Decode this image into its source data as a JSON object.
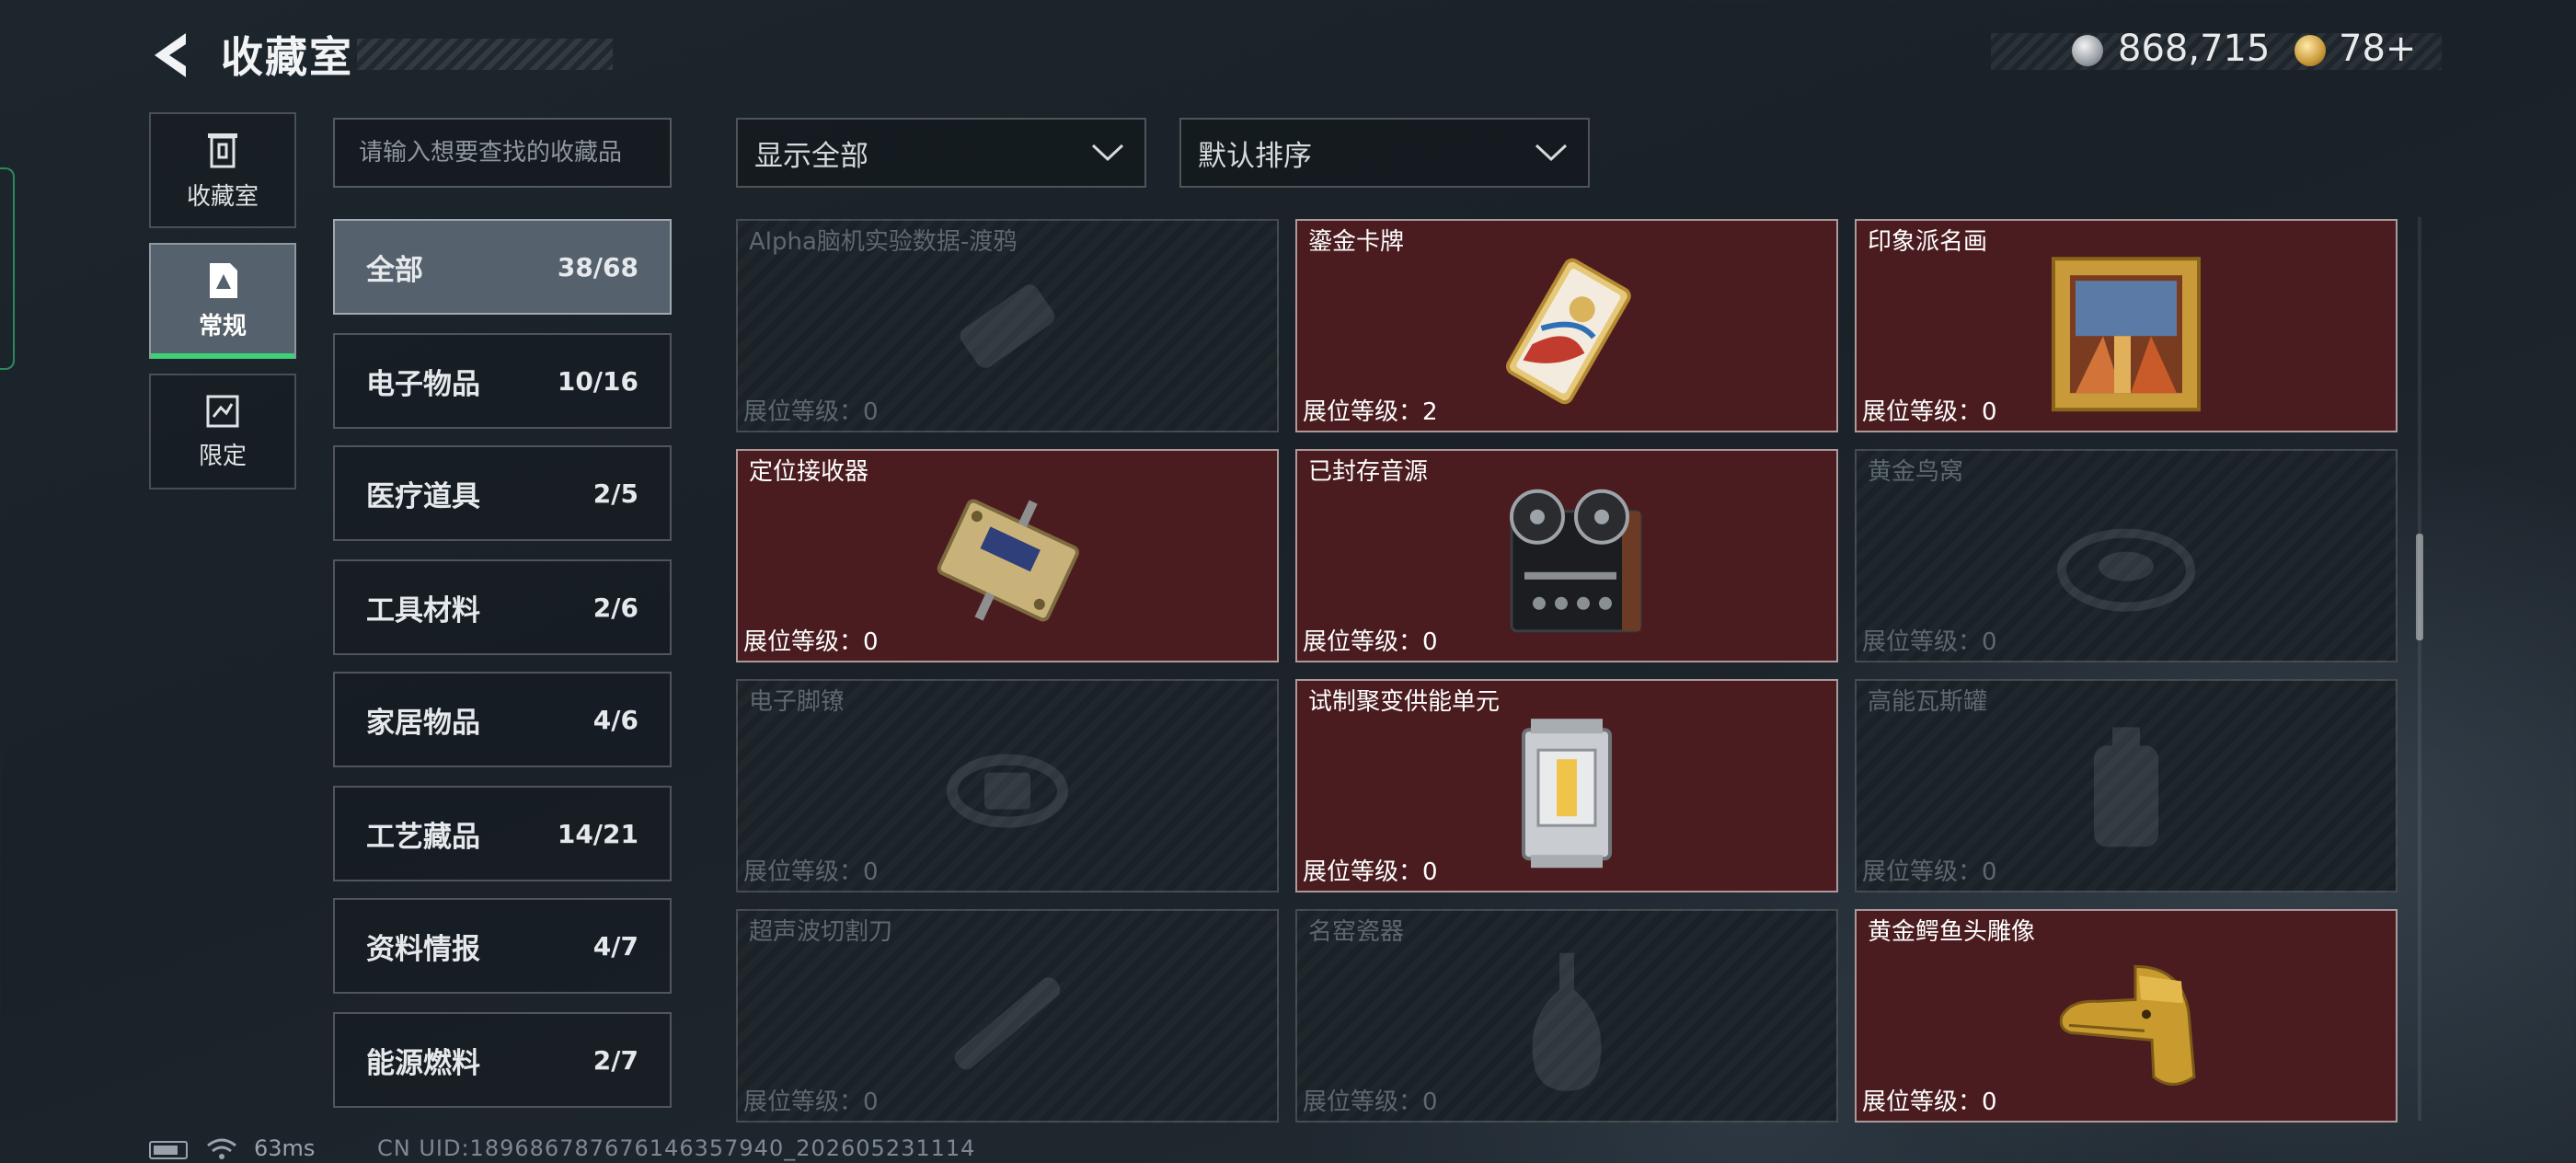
{
  "header": {
    "title": "收藏室",
    "silver_amount": "868,715",
    "gold_amount": "78+"
  },
  "nav": [
    {
      "label": "收藏室",
      "icon": "trash-bin-icon"
    },
    {
      "label": "常规",
      "icon": "collection-card-icon"
    },
    {
      "label": "限定",
      "icon": "limited-card-icon"
    }
  ],
  "search": {
    "placeholder": "请输入想要查找的收藏品"
  },
  "categories": [
    {
      "name": "全部",
      "count": "38/68"
    },
    {
      "name": "电子物品",
      "count": "10/16"
    },
    {
      "name": "医疗道具",
      "count": "2/5"
    },
    {
      "name": "工具材料",
      "count": "2/6"
    },
    {
      "name": "家居物品",
      "count": "4/6"
    },
    {
      "name": "工艺藏品",
      "count": "14/21"
    },
    {
      "name": "资料情报",
      "count": "4/7"
    },
    {
      "name": "能源燃料",
      "count": "2/7"
    }
  ],
  "filters": {
    "display": "显示全部",
    "sort": "默认排序"
  },
  "level_label": "展位等级：",
  "items": [
    {
      "name": "Alpha脑机实验数据-渡鸦",
      "level": "0",
      "owned": false,
      "icon": "usb-drive-icon"
    },
    {
      "name": "鎏金卡牌",
      "level": "2",
      "owned": true,
      "icon": "gilded-card-icon"
    },
    {
      "name": "印象派名画",
      "level": "0",
      "owned": true,
      "icon": "framed-painting-icon"
    },
    {
      "name": "定位接收器",
      "level": "0",
      "owned": true,
      "icon": "locator-receiver-icon"
    },
    {
      "name": "已封存音源",
      "level": "0",
      "owned": true,
      "icon": "reel-tape-recorder-icon"
    },
    {
      "name": "黄金鸟窝",
      "level": "0",
      "owned": false,
      "icon": "golden-nest-icon"
    },
    {
      "name": "电子脚镣",
      "level": "0",
      "owned": false,
      "icon": "ankle-monitor-icon"
    },
    {
      "name": "试制聚变供能单元",
      "level": "0",
      "owned": true,
      "icon": "fusion-cell-icon"
    },
    {
      "name": "高能瓦斯罐",
      "level": "0",
      "owned": false,
      "icon": "gas-canister-icon"
    },
    {
      "name": "超声波切割刀",
      "level": "0",
      "owned": false,
      "icon": "ultrasonic-cutter-icon"
    },
    {
      "name": "名窑瓷器",
      "level": "0",
      "owned": false,
      "icon": "porcelain-vase-icon"
    },
    {
      "name": "黄金鳄鱼头雕像",
      "level": "0",
      "owned": true,
      "icon": "golden-crocodile-head-icon"
    }
  ],
  "footer": {
    "ping": "63ms",
    "uid": "CN UID:189686787676146357940_202605231114"
  },
  "colors": {
    "owned_card_bg": "#4a1c1f",
    "active_tab_underline": "#3fd17a",
    "active_bg": "#55616c"
  }
}
